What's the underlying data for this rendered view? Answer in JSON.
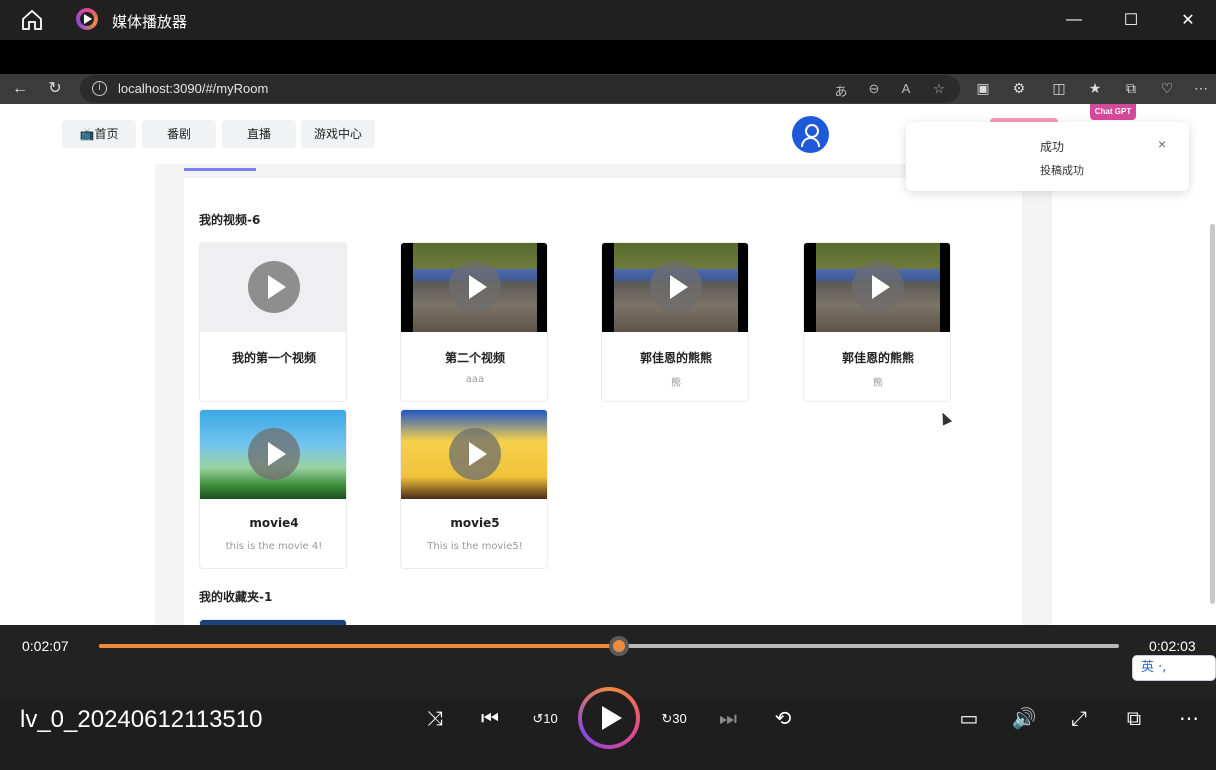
{
  "window": {
    "title": "媒体播放器",
    "controls": {
      "minimize": "—",
      "maximize": "☐",
      "close": "✕"
    }
  },
  "browser": {
    "url": "localhost:3090/#/myRoom",
    "icons": [
      "back-icon",
      "refresh-icon",
      "info-icon",
      "translate-icon",
      "zoom-out-icon",
      "read-aloud-icon",
      "favorite-icon",
      "screenshot-icon",
      "extensions-icon",
      "split-screen-icon",
      "favorites-icon",
      "collections-icon",
      "copilot-icon",
      "more-icon"
    ]
  },
  "site": {
    "tabs": [
      "首页",
      "番剧",
      "直播",
      "游戏中心"
    ],
    "chatgpt_label": "Chat GPT"
  },
  "toast": {
    "title": "成功",
    "message": "投稿成功",
    "close": "×"
  },
  "videos_section": {
    "title": "我的视频-6",
    "items": [
      {
        "title": "我的第一个视频",
        "desc": ""
      },
      {
        "title": "第二个视频",
        "desc": "aaa"
      },
      {
        "title": "郭佳恩的熊熊",
        "desc": "熊"
      },
      {
        "title": "郭佳恩的熊熊",
        "desc": "熊"
      },
      {
        "title": "movie4",
        "desc": "this is the movie 4!"
      },
      {
        "title": "movie5",
        "desc": "This is the movie5!"
      }
    ]
  },
  "favorites_section": {
    "title": "我的收藏夹-1"
  },
  "player": {
    "elapsed": "0:02:07",
    "remaining": "0:02:03",
    "progress_pct": 51,
    "filename": "lv_0_20240612113510",
    "rewind_label": "10",
    "forward_label": "30",
    "lang_badge": "英 ·,"
  },
  "colors": {
    "accent": "#f08a3b",
    "avatar": "#1e5ad8",
    "titlebar": "#202020"
  }
}
